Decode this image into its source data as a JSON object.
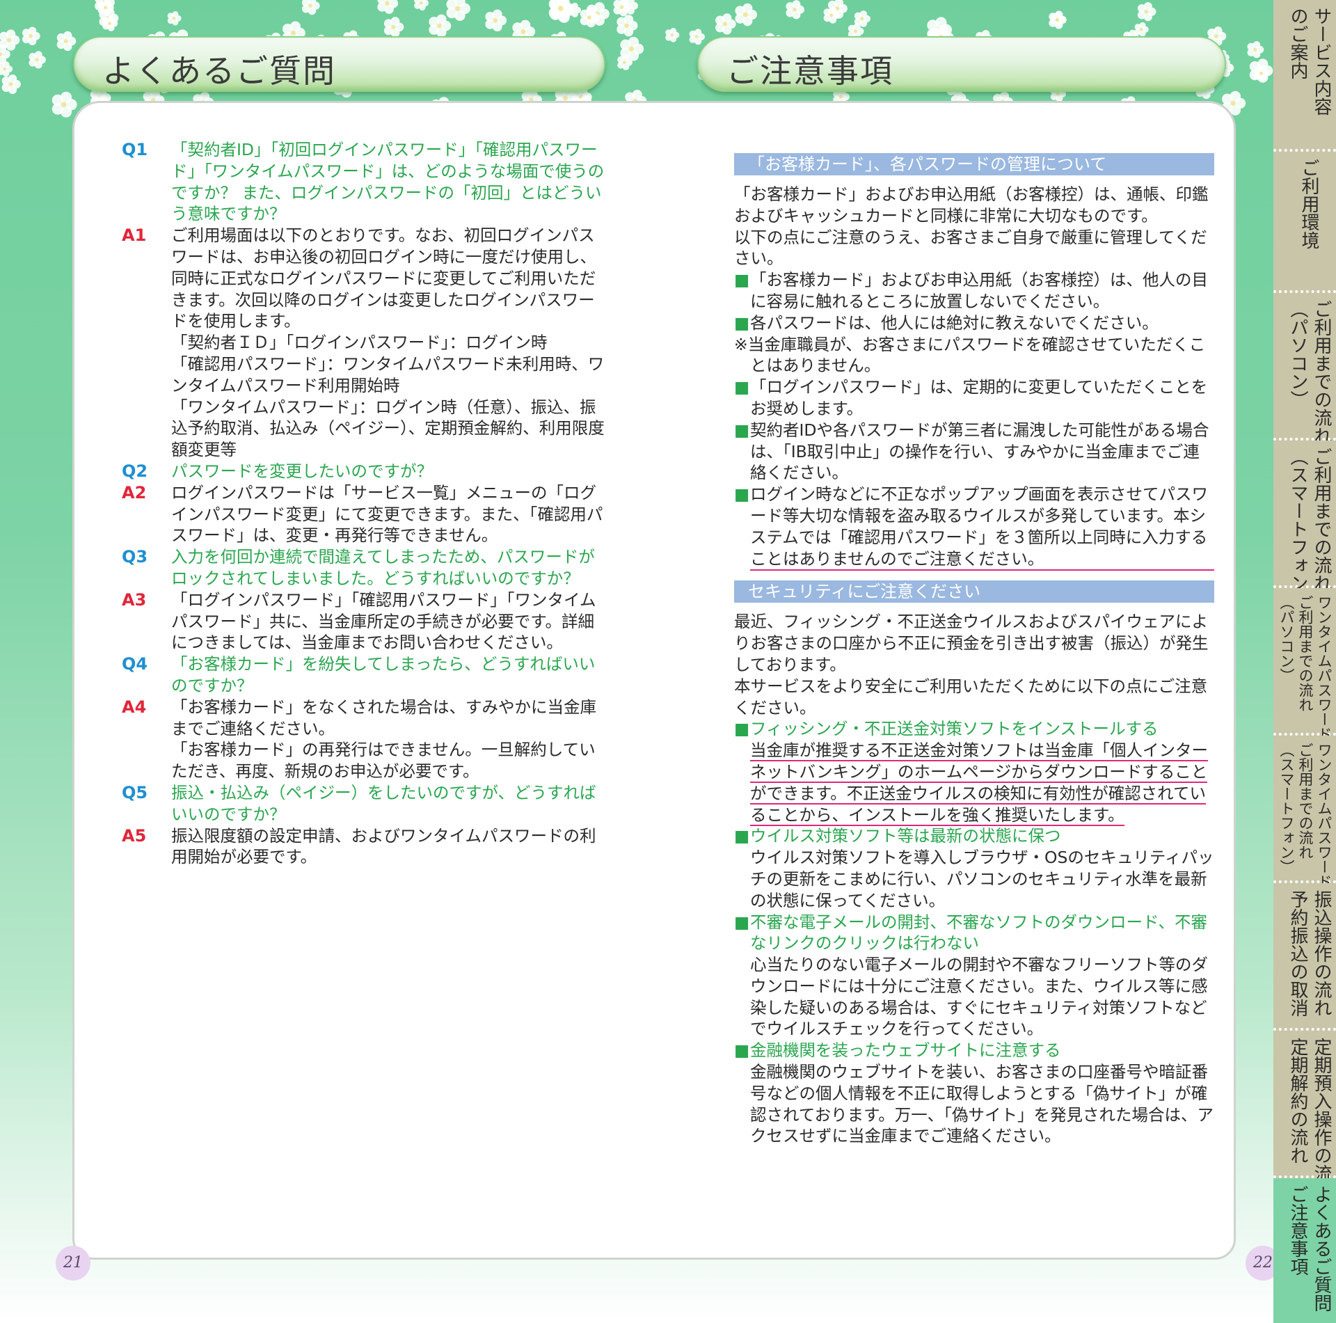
{
  "titles": {
    "left": "よくあるご質問",
    "right": "ご注意事項"
  },
  "faq": [
    {
      "q_label": "Q1",
      "q": "「契約者ID」「初回ログインパスワード」「確認用パスワード」「ワンタイムパスワード」は、どのような場面で使うのですか？ また、ログインパスワードの「初回」とはどういう意味ですか？",
      "a_label": "A1",
      "a": [
        "ご利用場面は以下のとおりです。なお、初回ログインパスワードは、お申込後の初回ログイン時に一度だけ使用し、同時に正式なログインパスワードに変更してご利用いただきます。次回以降のログインは変更したログインパスワードを使用します。",
        "「契約者ＩＤ」「ログインパスワード」：ログイン時",
        "「確認用パスワード」：ワンタイムパスワード未利用時、ワンタイムパスワード利用開始時",
        "「ワンタイムパスワード」：ログイン時（任意）、振込、振込予約取消、払込み（ペイジー）、定期預金解約、利用限度額変更等"
      ]
    },
    {
      "q_label": "Q2",
      "q": "パスワードを変更したいのですが？",
      "a_label": "A2",
      "a": [
        "ログインパスワードは「サービス一覧」メニューの「ログインパスワード変更」にて変更できます。また、「確認用パスワード」は、変更・再発行等できません。"
      ]
    },
    {
      "q_label": "Q3",
      "q": "入力を何回か連続で間違えてしまったため、パスワードがロックされてしまいました。どうすればいいのですか？",
      "a_label": "A3",
      "a": [
        "「ログインパスワード」「確認用パスワード」「ワンタイムパスワード」共に、当金庫所定の手続きが必要です。詳細につきましては、当金庫までお問い合わせください。"
      ]
    },
    {
      "q_label": "Q4",
      "q": "「お客様カード」を紛失してしまったら、どうすればいいのですか？",
      "a_label": "A4",
      "a": [
        "「お客様カード」をなくされた場合は、すみやかに当金庫までご連絡ください。",
        "「お客様カード」の再発行はできません。一旦解約していただき、再度、新規のお申込が必要です。"
      ]
    },
    {
      "q_label": "Q5",
      "q": "振込・払込み（ペイジー）をしたいのですが、どうすればいいのですか？",
      "a_label": "A5",
      "a": [
        "振込限度額の設定申請、およびワンタイムパスワードの利用開始が必要です。"
      ]
    }
  ],
  "notice": {
    "sec1_head": "「お客様カード」、各パスワードの管理について",
    "sec1_intro": [
      "「お客様カード」およびお申込用紙（お客様控）は、通帳、印鑑およびキャッシュカードと同様に非常に大切なものです。",
      "以下の点にご注意のうえ、お客さまご自身で厳重に管理してください。"
    ],
    "b1": "「お客様カード」およびお申込用紙（お客様控）は、他人の目に容易に触れるところに放置しないでください。",
    "b2": "各パスワードは、他人には絶対に教えないでください。",
    "note": "※当金庫職員が、お客さまにパスワードを確認させていただくことはありません。",
    "b3": "「ログインパスワード」は、定期的に変更していただくことをお奨めします。",
    "b4": "契約者IDや各パスワードが第三者に漏洩した可能性がある場合は、「IB取引中止」の操作を行い、すみやかに当金庫までご連絡ください。",
    "b5": "ログイン時などに不正なポップアップ画面を表示させてパスワード等大切な情報を盗み取るウイルスが多発しています。本システムでは「確認用パスワード」を３箇所以上同時に入力することはありませんのでご注意ください。",
    "sec2_head": "セキュリティにご注意ください",
    "sec2_intro": [
      "最近、フィッシング・不正送金ウイルスおよびスパイウェアによりお客さまの口座から不正に預金を引き出す被害（振込）が発生しております。",
      "本サービスをより安全にご利用いただくために以下の点にご注意ください。"
    ],
    "s1_head": "フィッシング・不正送金対策ソフトをインストールする",
    "s1_body": "当金庫が推奨する不正送金対策ソフトは当金庫「個人インターネットバンキング」のホームページからダウンロードすることができます。不正送金ウイルスの検知に有効性が確認されていることから、インストールを強く推奨いたします。",
    "s2_head": "ウイルス対策ソフト等は最新の状態に保つ",
    "s2_body": "ウイルス対策ソフトを導入しブラウザ・OSのセキュリティパッチの更新をこまめに行い、パソコンのセキュリティ水準を最新の状態に保ってください。",
    "s3_head": "不審な電子メールの開封、不審なソフトのダウンロード、不審なリンクのクリックは行わない",
    "s3_body": "心当たりのない電子メールの開封や不審なフリーソフト等のダウンロードには十分にご注意ください。また、ウイルス等に感染した疑いのある場合は、すぐにセキュリティ対策ソフトなどでウイルスチェックを行ってください。",
    "s4_head": "金融機関を装ったウェブサイトに注意する",
    "s4_body": "金融機関のウェブサイトを装い、お客さまの口座番号や暗証番号などの個人情報を不正に取得しようとする「偽サイト」が確認されております。万一、「偽サイト」を発見された場合は、アクセスせずに当金庫までご連絡ください。",
    "bullet_mark": "■"
  },
  "page_numbers": {
    "left": "21",
    "right": "22"
  },
  "tabs": [
    {
      "label": "サービス内容\nのご案内",
      "active": false
    },
    {
      "label": "ご利用環境",
      "active": false
    },
    {
      "label": "ご利用までの流れ\n（パソコン）",
      "active": false
    },
    {
      "label": "ご利用までの流れ\n（スマートフォン）",
      "active": false
    },
    {
      "label": "ワンタイムパスワード\nご利用までの流れ\n（パソコン）",
      "active": false
    },
    {
      "label": "ワンタイムパスワード\nご利用までの流れ\n（スマートフォン）",
      "active": false
    },
    {
      "label": "振込操作の流れ\n予約振込の取消",
      "active": false
    },
    {
      "label": "定期預入操作の流れ\n定期解約の流れ",
      "active": false
    },
    {
      "label": "よくあるご質問\nご注意事項",
      "active": true
    }
  ],
  "colors": {
    "background_green": "#7dd3a5",
    "question": "#2aa64f",
    "q_label": "#1f8fd0",
    "a_label": "#e0263a",
    "section_head": "#9ab8e0",
    "underline": "#e0287a",
    "tab": "#c9c5a8"
  }
}
